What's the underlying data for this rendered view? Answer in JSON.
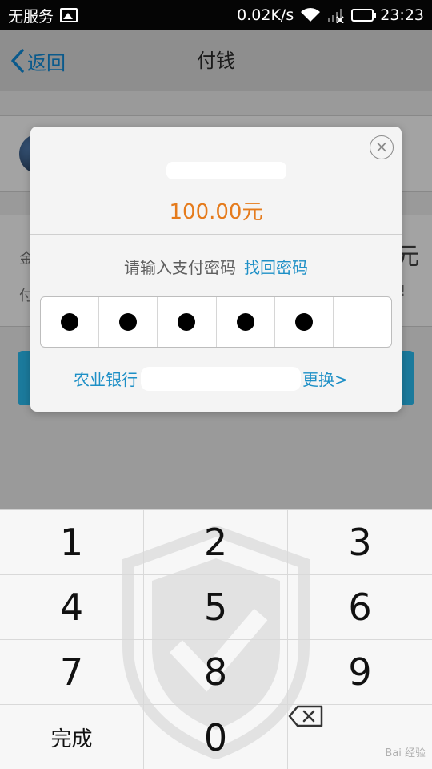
{
  "status_bar": {
    "carrier": "无服务",
    "speed": "0.02K/s",
    "time": "23:23",
    "icons": [
      "image-icon",
      "wifi-icon",
      "signal-icon",
      "battery-icon"
    ]
  },
  "nav": {
    "back_label": "返回",
    "title": "付钱"
  },
  "background": {
    "field_label_1": "金",
    "field_label_2": "付",
    "right_char": "元",
    "right_char_2": "!"
  },
  "dialog": {
    "amount": "100.00元",
    "password_prompt": "请输入支付密码",
    "forgot_password": "找回密码",
    "password_length": 6,
    "digits_entered": 5,
    "bank_name": "农业银行",
    "change_label": "更换>"
  },
  "keypad": {
    "keys": [
      "1",
      "2",
      "3",
      "4",
      "5",
      "6",
      "7",
      "8",
      "9",
      "完成",
      "0",
      "backspace"
    ],
    "watermark_text": "Bai 经验"
  },
  "colors": {
    "accent": "#1d8fc6",
    "amount": "#e57b1c",
    "battery": "#43d04a"
  }
}
